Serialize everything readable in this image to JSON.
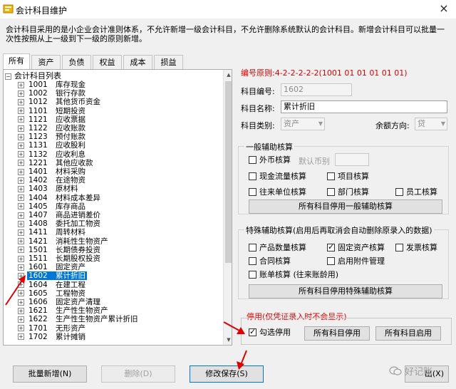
{
  "window": {
    "title": "会计科目维护",
    "close_label": "×"
  },
  "description": "会计科目采用的是小企业会计准则体系，不允许新增一级会计科目，不允许删除系统默认的会计科目。新增会计科目可以批量一次性按照从上一级到下一级的原则新增。",
  "tabs": [
    {
      "label": "所有",
      "active": true
    },
    {
      "label": "资产",
      "active": false
    },
    {
      "label": "负债",
      "active": false
    },
    {
      "label": "权益",
      "active": false
    },
    {
      "label": "成本",
      "active": false
    },
    {
      "label": "损益",
      "active": false
    }
  ],
  "tree": {
    "root_label": "会计科目列表",
    "items": [
      {
        "code": "1001",
        "name": "库存现金"
      },
      {
        "code": "1002",
        "name": "银行存款"
      },
      {
        "code": "1012",
        "name": "其他货币资金"
      },
      {
        "code": "1101",
        "name": "短期投资"
      },
      {
        "code": "1121",
        "name": "应收票据"
      },
      {
        "code": "1122",
        "name": "应收账款"
      },
      {
        "code": "1123",
        "name": "预付账款"
      },
      {
        "code": "1131",
        "name": "应收股利"
      },
      {
        "code": "1132",
        "name": "应收利息"
      },
      {
        "code": "1221",
        "name": "其他应收款"
      },
      {
        "code": "1401",
        "name": "材料采购"
      },
      {
        "code": "1402",
        "name": "在途物资"
      },
      {
        "code": "1403",
        "name": "原材料"
      },
      {
        "code": "1404",
        "name": "材料成本差异"
      },
      {
        "code": "1405",
        "name": "库存商品"
      },
      {
        "code": "1407",
        "name": "商品进销差价"
      },
      {
        "code": "1408",
        "name": "委托加工物资"
      },
      {
        "code": "1411",
        "name": "周转材料"
      },
      {
        "code": "1421",
        "name": "消耗性生物资产"
      },
      {
        "code": "1501",
        "name": "长期债券投资"
      },
      {
        "code": "1511",
        "name": "长期股权投资"
      },
      {
        "code": "1601",
        "name": "固定资产"
      },
      {
        "code": "1602",
        "name": "累计折旧",
        "selected": true
      },
      {
        "code": "1604",
        "name": "在建工程"
      },
      {
        "code": "1605",
        "name": "工程物资"
      },
      {
        "code": "1606",
        "name": "固定资产清理"
      },
      {
        "code": "1621",
        "name": "生产性生物资产"
      },
      {
        "code": "1622",
        "name": "生产性生物资产累计折旧"
      },
      {
        "code": "1701",
        "name": "无形资产"
      },
      {
        "code": "1702",
        "name": "累计摊销"
      }
    ]
  },
  "form": {
    "rule_label": "编号原则:4-2-2-2-2-2(1001 01 01 01 01 01)",
    "code_label": "科目编号:",
    "code_value": "1602",
    "name_label": "科目名称:",
    "name_value": "累计折旧",
    "category_label": "科目类别:",
    "category_value": "资产",
    "balance_label": "余额方向:",
    "balance_value": "贷"
  },
  "general_aux": {
    "title": "一般辅助核算",
    "foreign": "外币核算",
    "default_currency_label": "默认币别",
    "cashflow": "现金流量核算",
    "project": "项目核算",
    "counterparty": "往来单位核算",
    "department": "部门核算",
    "employee": "员工核算",
    "disable_all_button": "所有科目停用一般辅助核算"
  },
  "special_aux": {
    "title": "特殊辅助核算(启用后再取消会自动删除原录入的数据)",
    "quantity": "产品数量核算",
    "fixed_asset": "固定资产核算",
    "invoice": "发票核算",
    "contract": "合同核算",
    "attachment": "启用附件管理",
    "bill": "账单核算 (往来账龄用)",
    "disable_all_button": "所有科目停用特殊辅助核算"
  },
  "disable": {
    "title": "停用(仅凭证录入时不会显示)",
    "check_label": "勾选停用",
    "disable_all_button": "所有科目停用",
    "enable_all_button": "所有科目启用"
  },
  "bottom": {
    "batch_add": "批量新增(N)",
    "delete": "删除(D)",
    "save": "修改保存(S)",
    "exit_partial": "出(X)"
  },
  "watermark": "好记账"
}
